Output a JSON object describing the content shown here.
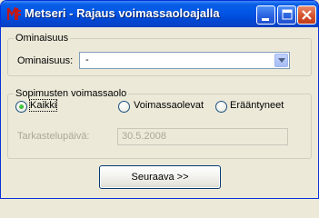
{
  "window": {
    "title": "Metseri - Rajaus voimassaoloajalla",
    "controls": [
      "minimize",
      "maximize",
      "close"
    ]
  },
  "property_group": {
    "legend": "Ominaisuus",
    "field_label": "Ominaisuus:",
    "selected_value": "-"
  },
  "contract_group": {
    "legend": "Sopimusten voimassaolo",
    "options": [
      {
        "label": "Kaikki",
        "selected": true
      },
      {
        "label": "Voimassaolevat",
        "selected": false
      },
      {
        "label": "Erääntyneet",
        "selected": false
      }
    ],
    "check_date_label": "Tarkastelupäivä:",
    "check_date_value": "30.5.2008"
  },
  "footer": {
    "next_label": "Seuraava >>"
  },
  "colors": {
    "titlebar": "#0055e5",
    "dialog_bg": "#ece9d8",
    "close_button": "#d5522c",
    "radio_dot": "#21a121"
  }
}
